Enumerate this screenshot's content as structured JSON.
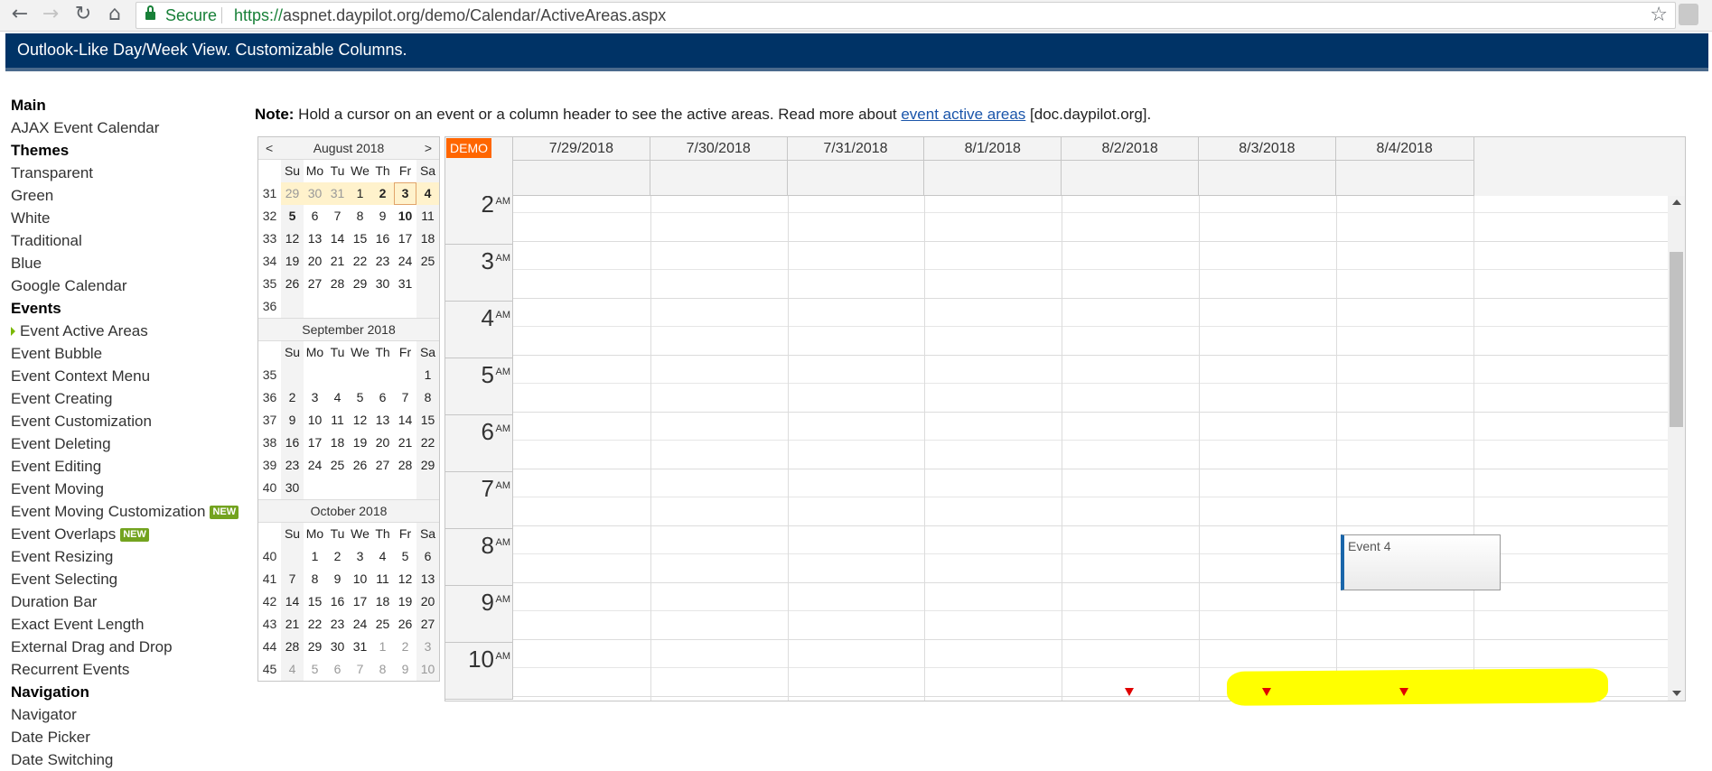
{
  "browser": {
    "secure_label": "Secure",
    "url_proto": "https://",
    "url_rest": "aspnet.daypilot.org/demo/Calendar/ActiveAreas.aspx",
    "back_icon": "←",
    "forward_icon": "→",
    "reload_icon": "↻",
    "home_icon": "⌂",
    "star_icon": "☆"
  },
  "header": {
    "title": "Outlook-Like Day/Week View. Customizable Columns."
  },
  "nav": {
    "items": [
      {
        "label": "Main",
        "type": "section"
      },
      {
        "label": "AJAX Event Calendar",
        "type": "link"
      },
      {
        "label": "Themes",
        "type": "section"
      },
      {
        "label": "Transparent",
        "type": "link"
      },
      {
        "label": "Green",
        "type": "link"
      },
      {
        "label": "White",
        "type": "link"
      },
      {
        "label": "Traditional",
        "type": "link"
      },
      {
        "label": "Blue",
        "type": "link"
      },
      {
        "label": "Google Calendar",
        "type": "link"
      },
      {
        "label": "Events",
        "type": "section"
      },
      {
        "label": "Event Active Areas",
        "type": "current"
      },
      {
        "label": "Event Bubble",
        "type": "link"
      },
      {
        "label": "Event Context Menu",
        "type": "link"
      },
      {
        "label": "Event Creating",
        "type": "link"
      },
      {
        "label": "Event Customization",
        "type": "link"
      },
      {
        "label": "Event Deleting",
        "type": "link"
      },
      {
        "label": "Event Editing",
        "type": "link"
      },
      {
        "label": "Event Moving",
        "type": "link"
      },
      {
        "label": "Event Moving Customization",
        "type": "link",
        "badge": "NEW"
      },
      {
        "label": "Event Overlaps",
        "type": "link",
        "badge": "NEW"
      },
      {
        "label": "Event Resizing",
        "type": "link"
      },
      {
        "label": "Event Selecting",
        "type": "link"
      },
      {
        "label": "Duration Bar",
        "type": "link"
      },
      {
        "label": "Exact Event Length",
        "type": "link"
      },
      {
        "label": "External Drag and Drop",
        "type": "link"
      },
      {
        "label": "Recurrent Events",
        "type": "link"
      },
      {
        "label": "Navigation",
        "type": "section"
      },
      {
        "label": "Navigator",
        "type": "link"
      },
      {
        "label": "Date Picker",
        "type": "link"
      },
      {
        "label": "Date Switching",
        "type": "link"
      }
    ]
  },
  "note": {
    "bold": "Note:",
    "text": " Hold a cursor on an event or a column header to see the active areas. Read more about ",
    "link": "event active areas",
    "tail": " [doc.daypilot.org]."
  },
  "navigator": {
    "prev": "<",
    "next": ">",
    "dow": [
      "Su",
      "Mo",
      "Tu",
      "We",
      "Th",
      "Fr",
      "Sa"
    ],
    "months": [
      {
        "title": "August 2018",
        "weeks": [
          {
            "wk": "31",
            "days": [
              "29",
              "30",
              "31",
              "1",
              "2",
              "3",
              "4"
            ],
            "other": [
              0,
              1,
              2
            ],
            "bold": [
              4,
              5,
              6
            ],
            "selected": true,
            "today": 5
          },
          {
            "wk": "32",
            "days": [
              "5",
              "6",
              "7",
              "8",
              "9",
              "10",
              "11"
            ],
            "bold": [
              0,
              5
            ]
          },
          {
            "wk": "33",
            "days": [
              "12",
              "13",
              "14",
              "15",
              "16",
              "17",
              "18"
            ]
          },
          {
            "wk": "34",
            "days": [
              "19",
              "20",
              "21",
              "22",
              "23",
              "24",
              "25"
            ]
          },
          {
            "wk": "35",
            "days": [
              "26",
              "27",
              "28",
              "29",
              "30",
              "31",
              ""
            ]
          },
          {
            "wk": "36",
            "days": [
              "",
              "",
              "",
              "",
              "",
              "",
              ""
            ]
          }
        ]
      },
      {
        "title": "September 2018",
        "weeks": [
          {
            "wk": "35",
            "days": [
              "",
              "",
              "",
              "",
              "",
              "",
              "1"
            ]
          },
          {
            "wk": "36",
            "days": [
              "2",
              "3",
              "4",
              "5",
              "6",
              "7",
              "8"
            ]
          },
          {
            "wk": "37",
            "days": [
              "9",
              "10",
              "11",
              "12",
              "13",
              "14",
              "15"
            ]
          },
          {
            "wk": "38",
            "days": [
              "16",
              "17",
              "18",
              "19",
              "20",
              "21",
              "22"
            ]
          },
          {
            "wk": "39",
            "days": [
              "23",
              "24",
              "25",
              "26",
              "27",
              "28",
              "29"
            ]
          },
          {
            "wk": "40",
            "days": [
              "30",
              "",
              "",
              "",
              "",
              "",
              ""
            ]
          }
        ]
      },
      {
        "title": "October 2018",
        "weeks": [
          {
            "wk": "40",
            "days": [
              "",
              "1",
              "2",
              "3",
              "4",
              "5",
              "6"
            ]
          },
          {
            "wk": "41",
            "days": [
              "7",
              "8",
              "9",
              "10",
              "11",
              "12",
              "13"
            ]
          },
          {
            "wk": "42",
            "days": [
              "14",
              "15",
              "16",
              "17",
              "18",
              "19",
              "20"
            ]
          },
          {
            "wk": "43",
            "days": [
              "21",
              "22",
              "23",
              "24",
              "25",
              "26",
              "27"
            ]
          },
          {
            "wk": "44",
            "days": [
              "28",
              "29",
              "30",
              "31",
              "1",
              "2",
              "3"
            ],
            "other": [
              4,
              5,
              6
            ]
          },
          {
            "wk": "45",
            "days": [
              "4",
              "5",
              "6",
              "7",
              "8",
              "9",
              "10"
            ],
            "other": [
              0,
              1,
              2,
              3,
              4,
              5,
              6
            ]
          }
        ]
      }
    ]
  },
  "calendar": {
    "demo_label": "DEMO",
    "columns": [
      "7/29/2018",
      "7/30/2018",
      "7/31/2018",
      "8/1/2018",
      "8/2/2018",
      "8/3/2018",
      "8/4/2018"
    ],
    "hours": [
      {
        "num": "2",
        "ampm": "AM"
      },
      {
        "num": "3",
        "ampm": "AM"
      },
      {
        "num": "4",
        "ampm": "AM"
      },
      {
        "num": "5",
        "ampm": "AM"
      },
      {
        "num": "6",
        "ampm": "AM"
      },
      {
        "num": "7",
        "ampm": "AM"
      },
      {
        "num": "8",
        "ampm": "AM"
      },
      {
        "num": "9",
        "ampm": "AM"
      },
      {
        "num": "10",
        "ampm": "AM"
      }
    ],
    "event": {
      "text": "Event 4",
      "column": "8/3/2018",
      "start": "8 AM",
      "end": "9 AM"
    },
    "active_area_columns": [
      "8/2/2018",
      "8/3/2018",
      "8/4/2018"
    ]
  },
  "colors": {
    "header_bg": "#003366",
    "demo_tag": "#ff6600",
    "event_bar": "#1a66aa",
    "highlight": "#ffff00",
    "active_area_arrow": "#e00000",
    "new_badge": "#73a31f"
  }
}
